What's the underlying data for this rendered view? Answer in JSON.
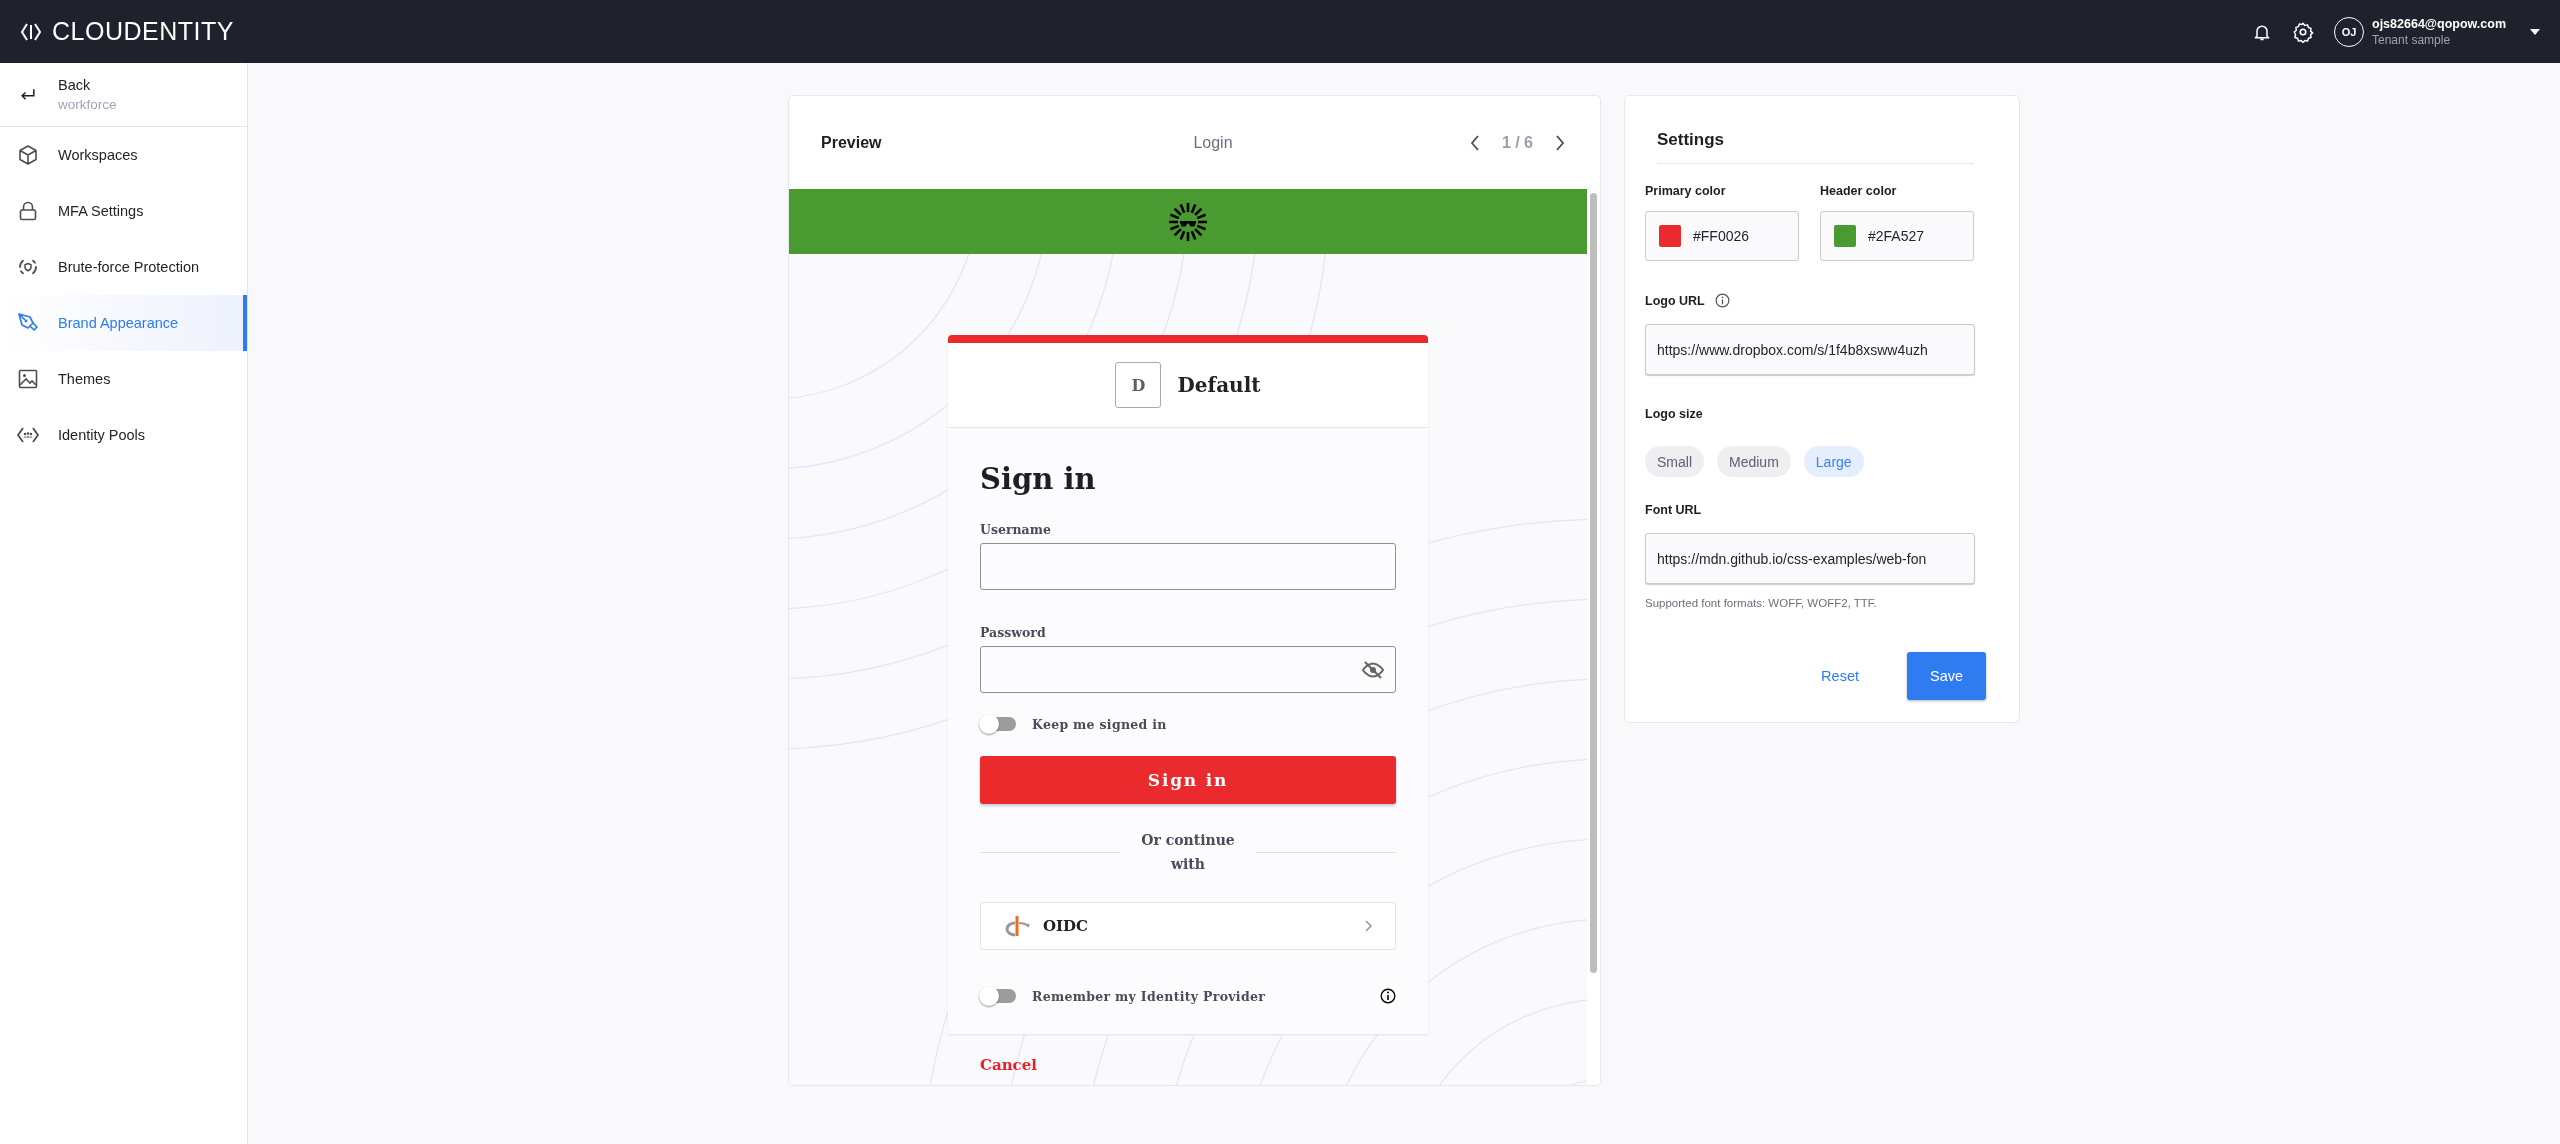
{
  "topbar": {
    "brand": "CLOUDENTITY",
    "user": {
      "initials": "OJ",
      "email": "ojs82664@qopow.com",
      "tenant": "Tenant sample"
    }
  },
  "sidebar": {
    "back": {
      "label": "Back",
      "sublabel": "workforce"
    },
    "items": [
      {
        "label": "Workspaces",
        "kind": "cube",
        "selected": false
      },
      {
        "label": "MFA Settings",
        "kind": "lock",
        "selected": false
      },
      {
        "label": "Brute-force Protection",
        "kind": "shield",
        "selected": false
      },
      {
        "label": "Brand Appearance",
        "kind": "pen",
        "selected": true
      },
      {
        "label": "Themes",
        "kind": "image",
        "selected": false
      },
      {
        "label": "Identity Pools",
        "kind": "pool",
        "selected": false
      }
    ]
  },
  "preview": {
    "title": "Preview",
    "page": "Login",
    "pager": "1 / 6",
    "login": {
      "logo_letter": "D",
      "workspace": "Default",
      "heading": "Sign in",
      "fields": [
        {
          "label": "Username",
          "kind": "text"
        },
        {
          "label": "Password",
          "kind": "password"
        }
      ],
      "keep_signed_in": {
        "label": "Keep me signed in",
        "on": false
      },
      "submit": "Sign in",
      "divider": "Or continue with",
      "providers": [
        {
          "name": "OIDC"
        }
      ],
      "remember": {
        "label": "Remember my Identity Provider",
        "on": false
      },
      "cancel": "Cancel"
    }
  },
  "settings": {
    "title": "Settings",
    "colors": [
      {
        "label": "Primary color",
        "value": "#FF0026",
        "color": "#ea2a2c"
      },
      {
        "label": "Header color",
        "value": "#2FA527",
        "color": "#4a9a32"
      }
    ],
    "logo_url": {
      "label": "Logo URL",
      "value": "https://www.dropbox.com/s/1f4b8xsww4uzh"
    },
    "logo_size": {
      "label": "Logo size",
      "options": [
        {
          "label": "Small",
          "selected": false
        },
        {
          "label": "Medium",
          "selected": false
        },
        {
          "label": "Large",
          "selected": true
        }
      ]
    },
    "font_url": {
      "label": "Font URL",
      "value": "https://mdn.github.io/css-examples/web-fon",
      "help": "Supported font formats: WOFF, WOFF2, TTF."
    },
    "actions": {
      "reset": "Reset",
      "save": "Save"
    }
  }
}
